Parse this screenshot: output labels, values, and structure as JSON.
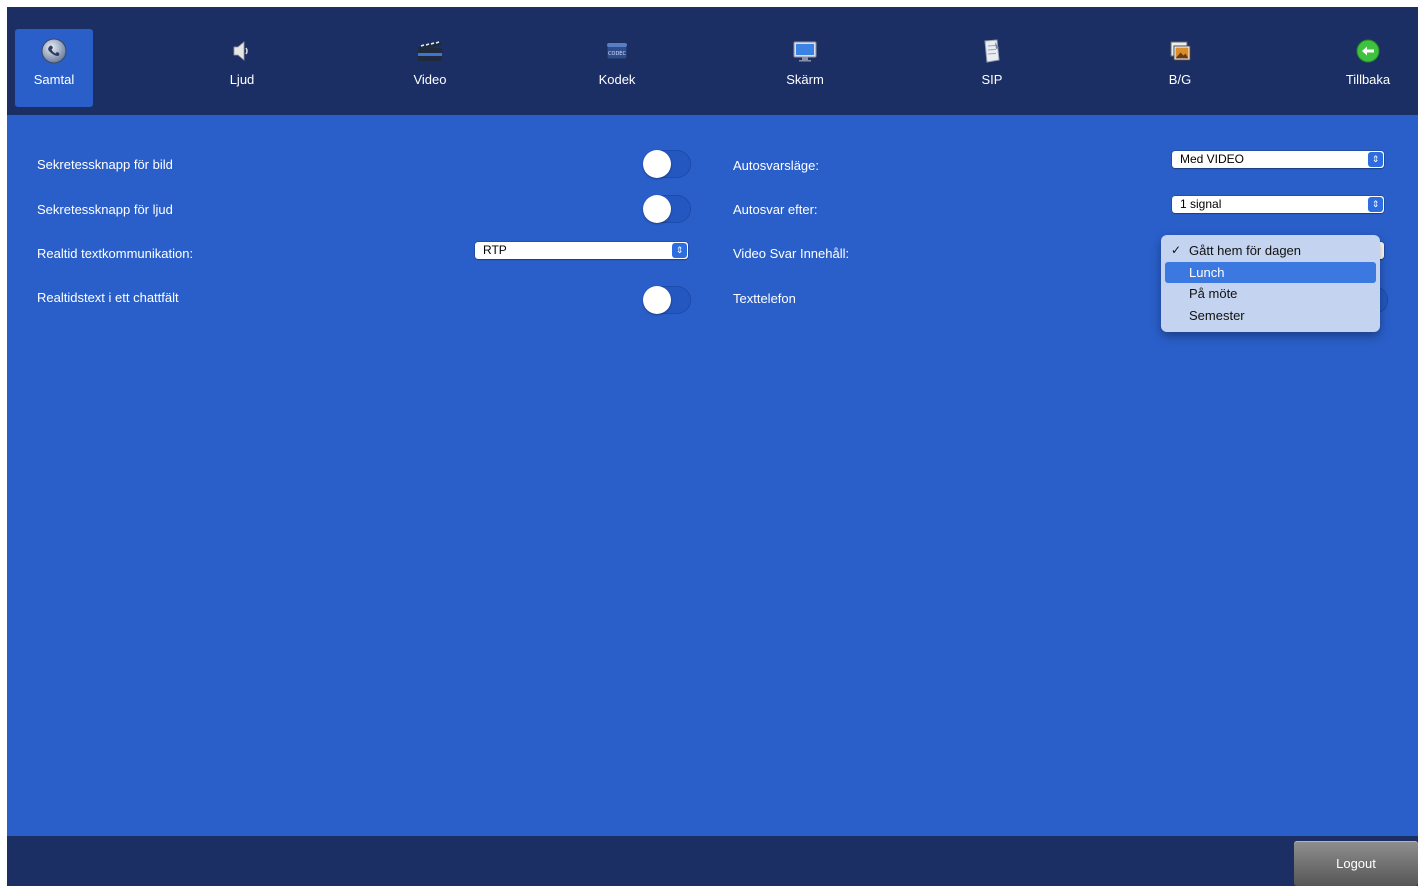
{
  "toolbar": {
    "items": [
      {
        "label": "Samtal",
        "icon": "phone-settings-icon",
        "active": true
      },
      {
        "label": "Ljud",
        "icon": "speaker-icon"
      },
      {
        "label": "Video",
        "icon": "clapperboard-icon"
      },
      {
        "label": "Kodek",
        "icon": "codec-icon"
      },
      {
        "label": "Skärm",
        "icon": "monitor-icon"
      },
      {
        "label": "SIP",
        "icon": "document-icon"
      },
      {
        "label": "B/G",
        "icon": "picture-icon"
      },
      {
        "label": "Tillbaka",
        "icon": "back-arrow-icon"
      }
    ]
  },
  "left": {
    "video_privacy_label": "Sekretessknapp för bild",
    "video_privacy_on": false,
    "audio_privacy_label": "Sekretessknapp för ljud",
    "audio_privacy_on": false,
    "rtt_label": "Realtid textkommunikation:",
    "rtt_value": "RTP",
    "rtt_chat_label": "Realtidstext i ett chattfält",
    "rtt_chat_on": false
  },
  "right": {
    "autoanswer_mode_label": "Autosvarsläge:",
    "autoanswer_mode_value": "Med VIDEO",
    "autoanswer_after_label": "Autosvar efter:",
    "autoanswer_after_value": "1 signal",
    "video_answer_label": "Video Svar Innehåll:",
    "texttelephone_label": "Texttelefon"
  },
  "dropdown": {
    "options": [
      "Gått hem för dagen",
      "Lunch",
      "På möte",
      "Semester"
    ],
    "checked": "Gått hem för dagen",
    "highlighted": "Lunch"
  },
  "footer": {
    "logout_label": "Logout"
  },
  "colors": {
    "background": "#2a5fca",
    "bar": "#1c2f64",
    "accent": "#3b78df"
  }
}
